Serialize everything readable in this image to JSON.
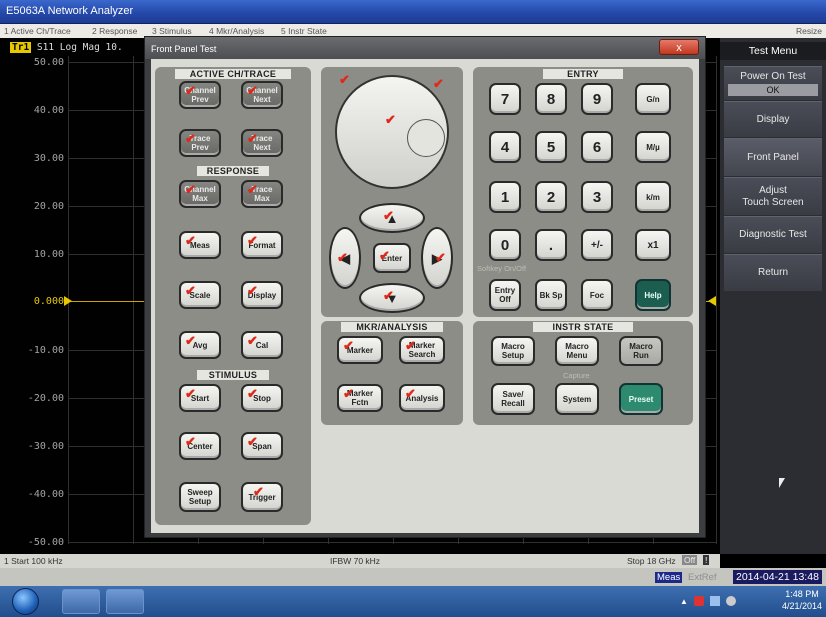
{
  "window": {
    "title": "E5063A Network Analyzer"
  },
  "menubar": {
    "items": [
      "1 Active Ch/Trace",
      "2 Response",
      "3 Stimulus",
      "4 Mkr/Analysis",
      "5 Instr State"
    ],
    "resize": "Resize"
  },
  "trace": {
    "badge": "Tr1",
    "label": "S11 Log Mag 10."
  },
  "y_axis": {
    "labels": [
      "50.00",
      "40.00",
      "30.00",
      "20.00",
      "10.00",
      "0.000",
      "-10.00",
      "-20.00",
      "-30.00",
      "-40.00",
      "-50.00"
    ]
  },
  "status": {
    "start": "1 Start 100 kHz",
    "ifbw": "IFBW 70 kHz",
    "stop": "Stop 18 GHz",
    "off": "Off",
    "bang": "!",
    "meas": "Meas",
    "extref": "ExtRef",
    "datetime": "2014-04-21 13:48"
  },
  "softkeys": {
    "header": "Test Menu",
    "items": [
      {
        "label": "Power On Test",
        "sub": "OK"
      },
      {
        "label": "Display",
        "sub": ""
      },
      {
        "label": "Front Panel",
        "sub": ""
      },
      {
        "label": "Adjust",
        "sub": "Touch Screen"
      },
      {
        "label": "Diagnostic Test",
        "sub": ""
      },
      {
        "label": "Return",
        "sub": ""
      }
    ]
  },
  "dialog": {
    "title": "Front Panel Test",
    "close": "x"
  },
  "sections": {
    "active": "ACTIVE CH/TRACE",
    "response": "RESPONSE",
    "stimulus": "STIMULUS",
    "entry": "ENTRY",
    "mkr": "MKR/ANALYSIS",
    "instr": "INSTR STATE"
  },
  "keys": {
    "ch_prev": "Channel Prev",
    "ch_next": "Channel Next",
    "tr_prev": "Trace Prev",
    "tr_next": "Trace Next",
    "ch_max": "Channel Max",
    "tr_max": "Trace Max",
    "meas": "Meas",
    "format": "Format",
    "scale": "Scale",
    "display": "Display",
    "avg": "Avg",
    "cal": "Cal",
    "start": "Start",
    "stop": "Stop",
    "center": "Center",
    "span": "Span",
    "sweep": "Sweep Setup",
    "trigger": "Trigger",
    "enter": "Enter",
    "marker": "Marker",
    "marker_search": "Marker Search",
    "marker_fctn": "Marker Fctn",
    "analysis": "Analysis",
    "n7": "7",
    "n8": "8",
    "n9": "9",
    "gn": "G/n",
    "n4": "4",
    "n5": "5",
    "n6": "6",
    "mu": "M/µ",
    "n1": "1",
    "n2": "2",
    "n3": "3",
    "km": "k/m",
    "n0": "0",
    "dot": ".",
    "pm": "+/-",
    "x1": "x1",
    "entry_off": "Entry Off",
    "bksp": "Bk Sp",
    "foc": "Foc",
    "help": "Help",
    "macro_setup": "Macro Setup",
    "macro_menu": "Macro Menu",
    "macro_run": "Macro Run",
    "save": "Save/ Recall",
    "system": "System",
    "preset": "Preset"
  },
  "labels": {
    "softkey_onoff": "Softkey On/Off",
    "capture": "Capture"
  },
  "taskbar": {
    "time": "1:48 PM",
    "date": "4/21/2014"
  }
}
